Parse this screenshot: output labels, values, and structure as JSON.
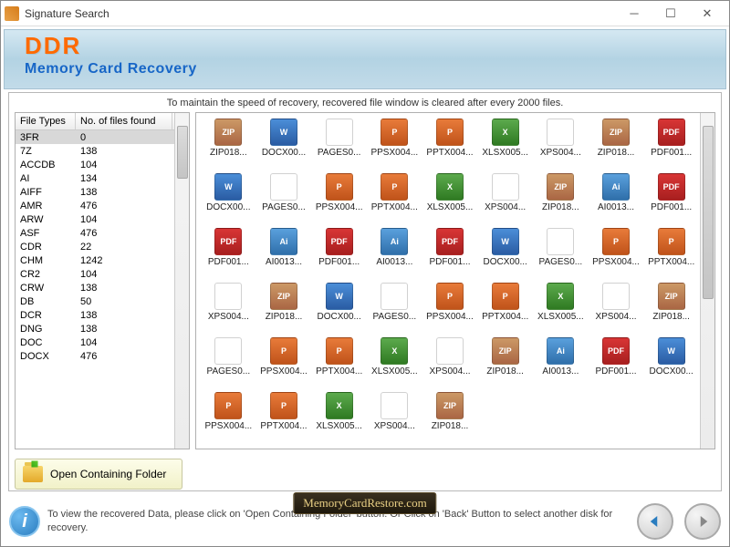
{
  "window": {
    "title": "Signature Search"
  },
  "banner": {
    "brand": "DDR",
    "subtitle": "Memory Card Recovery"
  },
  "info_bar": "To maintain the speed of recovery, recovered file window is cleared after every 2000 files.",
  "file_types_table": {
    "col1": "File Types",
    "col2": "No. of files found",
    "rows": [
      {
        "type": "3FR",
        "count": "0",
        "selected": true
      },
      {
        "type": "7Z",
        "count": "138"
      },
      {
        "type": "ACCDB",
        "count": "104"
      },
      {
        "type": "AI",
        "count": "134"
      },
      {
        "type": "AIFF",
        "count": "138"
      },
      {
        "type": "AMR",
        "count": "476"
      },
      {
        "type": "ARW",
        "count": "104"
      },
      {
        "type": "ASF",
        "count": "476"
      },
      {
        "type": "CDR",
        "count": "22"
      },
      {
        "type": "CHM",
        "count": "1242"
      },
      {
        "type": "CR2",
        "count": "104"
      },
      {
        "type": "CRW",
        "count": "138"
      },
      {
        "type": "DB",
        "count": "50"
      },
      {
        "type": "DCR",
        "count": "138"
      },
      {
        "type": "DNG",
        "count": "138"
      },
      {
        "type": "DOC",
        "count": "104"
      },
      {
        "type": "DOCX",
        "count": "476"
      }
    ]
  },
  "files": [
    {
      "name": "ZIP018...",
      "cls": "ic-zip"
    },
    {
      "name": "DOCX00...",
      "cls": "ic-doc"
    },
    {
      "name": "PAGES0...",
      "cls": "ic-page"
    },
    {
      "name": "PPSX004...",
      "cls": "ic-ppt"
    },
    {
      "name": "PPTX004...",
      "cls": "ic-ppt"
    },
    {
      "name": "XLSX005...",
      "cls": "ic-xls"
    },
    {
      "name": "XPS004...",
      "cls": "ic-xps"
    },
    {
      "name": "ZIP018...",
      "cls": "ic-zip"
    },
    {
      "name": "PDF001...",
      "cls": "ic-pdf"
    },
    {
      "name": "DOCX00...",
      "cls": "ic-doc"
    },
    {
      "name": "PAGES0...",
      "cls": "ic-page"
    },
    {
      "name": "PPSX004...",
      "cls": "ic-ppt"
    },
    {
      "name": "PPTX004...",
      "cls": "ic-ppt"
    },
    {
      "name": "XLSX005...",
      "cls": "ic-xls"
    },
    {
      "name": "XPS004...",
      "cls": "ic-xps"
    },
    {
      "name": "ZIP018...",
      "cls": "ic-zip"
    },
    {
      "name": "AI0013...",
      "cls": "ic-ai"
    },
    {
      "name": "PDF001...",
      "cls": "ic-pdf"
    },
    {
      "name": "PDF001...",
      "cls": "ic-pdf"
    },
    {
      "name": "AI0013...",
      "cls": "ic-ai"
    },
    {
      "name": "PDF001...",
      "cls": "ic-pdf"
    },
    {
      "name": "AI0013...",
      "cls": "ic-ai"
    },
    {
      "name": "PDF001...",
      "cls": "ic-pdf"
    },
    {
      "name": "DOCX00...",
      "cls": "ic-doc"
    },
    {
      "name": "PAGES0...",
      "cls": "ic-page"
    },
    {
      "name": "PPSX004...",
      "cls": "ic-ppt"
    },
    {
      "name": "PPTX004...",
      "cls": "ic-ppt"
    },
    {
      "name": "XPS004...",
      "cls": "ic-xps"
    },
    {
      "name": "ZIP018...",
      "cls": "ic-zip"
    },
    {
      "name": "DOCX00...",
      "cls": "ic-doc"
    },
    {
      "name": "PAGES0...",
      "cls": "ic-page"
    },
    {
      "name": "PPSX004...",
      "cls": "ic-ppt"
    },
    {
      "name": "PPTX004...",
      "cls": "ic-ppt"
    },
    {
      "name": "XLSX005...",
      "cls": "ic-xls"
    },
    {
      "name": "XPS004...",
      "cls": "ic-xps"
    },
    {
      "name": "ZIP018...",
      "cls": "ic-zip"
    },
    {
      "name": "PAGES0...",
      "cls": "ic-page"
    },
    {
      "name": "PPSX004...",
      "cls": "ic-ppt"
    },
    {
      "name": "PPTX004...",
      "cls": "ic-ppt"
    },
    {
      "name": "XLSX005...",
      "cls": "ic-xls"
    },
    {
      "name": "XPS004...",
      "cls": "ic-xps"
    },
    {
      "name": "ZIP018...",
      "cls": "ic-zip"
    },
    {
      "name": "AI0013...",
      "cls": "ic-ai"
    },
    {
      "name": "PDF001...",
      "cls": "ic-pdf"
    },
    {
      "name": "DOCX00...",
      "cls": "ic-doc"
    },
    {
      "name": "PPSX004...",
      "cls": "ic-ppt"
    },
    {
      "name": "PPTX004...",
      "cls": "ic-ppt"
    },
    {
      "name": "XLSX005...",
      "cls": "ic-xls"
    },
    {
      "name": "XPS004...",
      "cls": "ic-xps"
    },
    {
      "name": "ZIP018...",
      "cls": "ic-zip"
    }
  ],
  "open_folder_btn": "Open Containing Folder",
  "footer_text": "To view the recovered Data, please click on 'Open Containing Folder' button. Or Click on 'Back' Button to select another disk for recovery.",
  "watermark": "MemoryCardRestore.com"
}
